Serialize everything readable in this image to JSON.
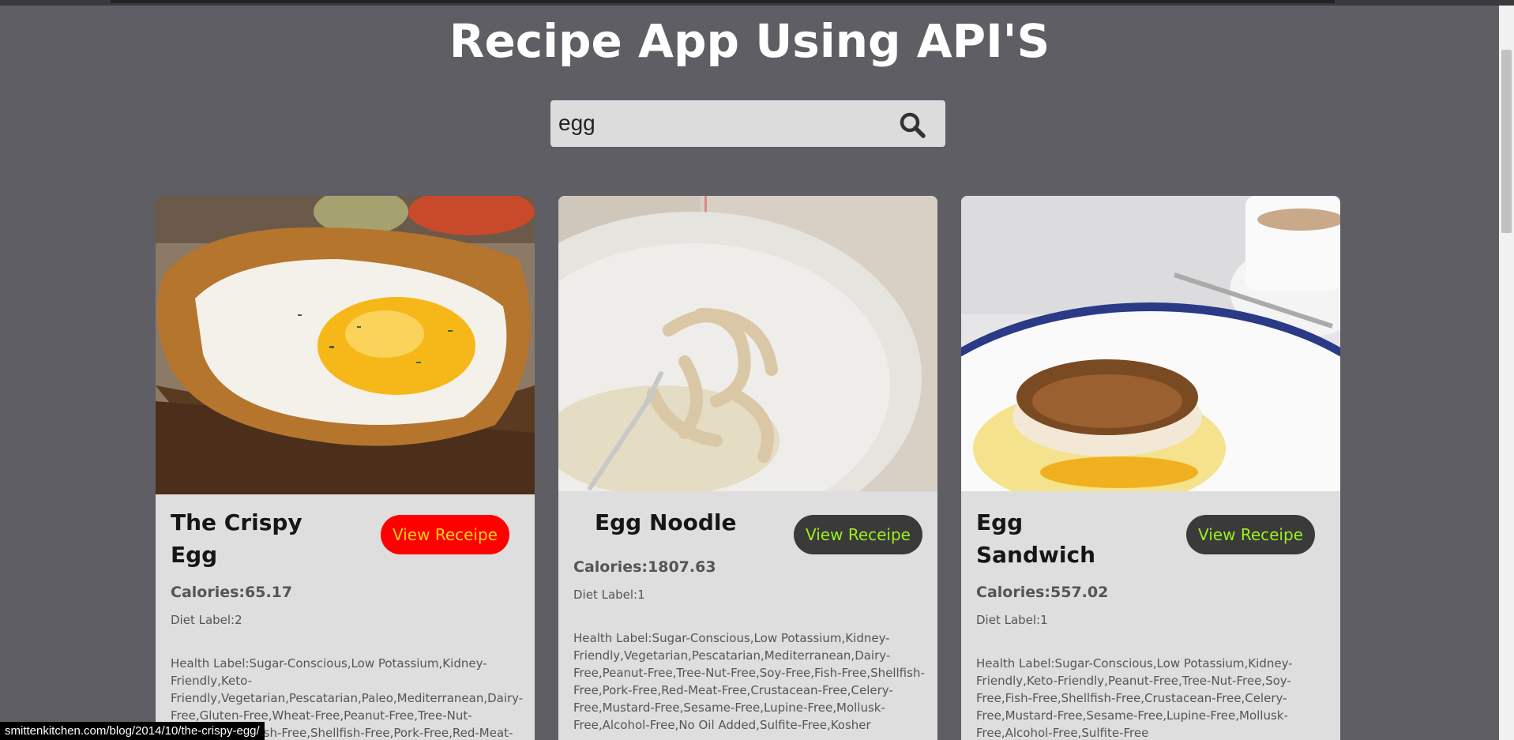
{
  "page": {
    "title": "Recipe App Using API'S"
  },
  "search": {
    "value": "egg",
    "icon": "search-icon"
  },
  "recipes": [
    {
      "title": "The Crispy Egg",
      "button": "View Receipe",
      "button_bg": "#ff0000",
      "button_fg": "#ffd21f",
      "calories": "Calories:65.17",
      "diet": "Diet Label:2",
      "health": "Health Label:Sugar-Conscious,Low Potassium,Kidney-Friendly,Keto-Friendly,Vegetarian,Pescatarian,Paleo,Mediterranean,Dairy-Free,Gluten-Free,Wheat-Free,Peanut-Free,Tree-Nut-Free,Soy-Free,Fish-Free,Shellfish-Free,Pork-Free,Red-Meat-"
    },
    {
      "title": "Egg Noodle",
      "button": "View Receipe",
      "button_bg": "#3a3a3a",
      "button_fg": "#9cef1f",
      "calories": "Calories:1807.63",
      "diet": "Diet Label:1",
      "health": "Health Label:Sugar-Conscious,Low Potassium,Kidney-Friendly,Vegetarian,Pescatarian,Mediterranean,Dairy-Free,Peanut-Free,Tree-Nut-Free,Soy-Free,Fish-Free,Shellfish-Free,Pork-Free,Red-Meat-Free,Crustacean-Free,Celery-Free,Mustard-Free,Sesame-Free,Lupine-Free,Mollusk-Free,Alcohol-Free,No Oil Added,Sulfite-Free,Kosher"
    },
    {
      "title": "Egg Sandwich",
      "button": "View Receipe",
      "button_bg": "#3a3a3a",
      "button_fg": "#9cef1f",
      "calories": "Calories:557.02",
      "diet": "Diet Label:1",
      "health": "Health Label:Sugar-Conscious,Low Potassium,Kidney-Friendly,Keto-Friendly,Peanut-Free,Tree-Nut-Free,Soy-Free,Fish-Free,Shellfish-Free,Crustacean-Free,Celery-Free,Mustard-Free,Sesame-Free,Lupine-Free,Mollusk-Free,Alcohol-Free,Sulfite-Free"
    }
  ],
  "status_bar": {
    "url": "smittenkitchen.com/blog/2014/10/the-crispy-egg/"
  }
}
